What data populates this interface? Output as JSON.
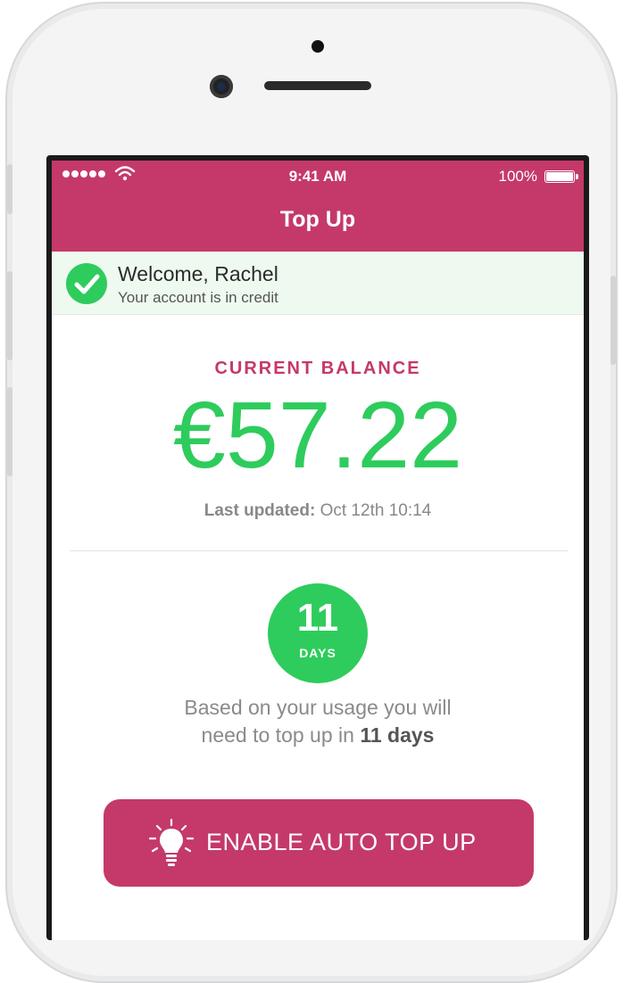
{
  "status_bar": {
    "time": "9:41 AM",
    "battery": "100%"
  },
  "header": {
    "title": "Top Up"
  },
  "welcome": {
    "title": "Welcome, Rachel",
    "subtitle": "Your account is in credit"
  },
  "balance": {
    "label": "CURRENT BALANCE",
    "amount": "€57.22",
    "updated_label": "Last updated:",
    "updated_value": "Oct 12th 10:14"
  },
  "days": {
    "number": "11",
    "label": "DAYS"
  },
  "usage": {
    "line1": "Based on your usage you will",
    "line2_prefix": "need to top up in ",
    "line2_bold": "11 days"
  },
  "cta": {
    "label": "ENABLE AUTO TOP UP",
    "icon": "lightbulb-icon"
  },
  "colors": {
    "brand": "#c4396a",
    "success": "#2ecc5c"
  }
}
